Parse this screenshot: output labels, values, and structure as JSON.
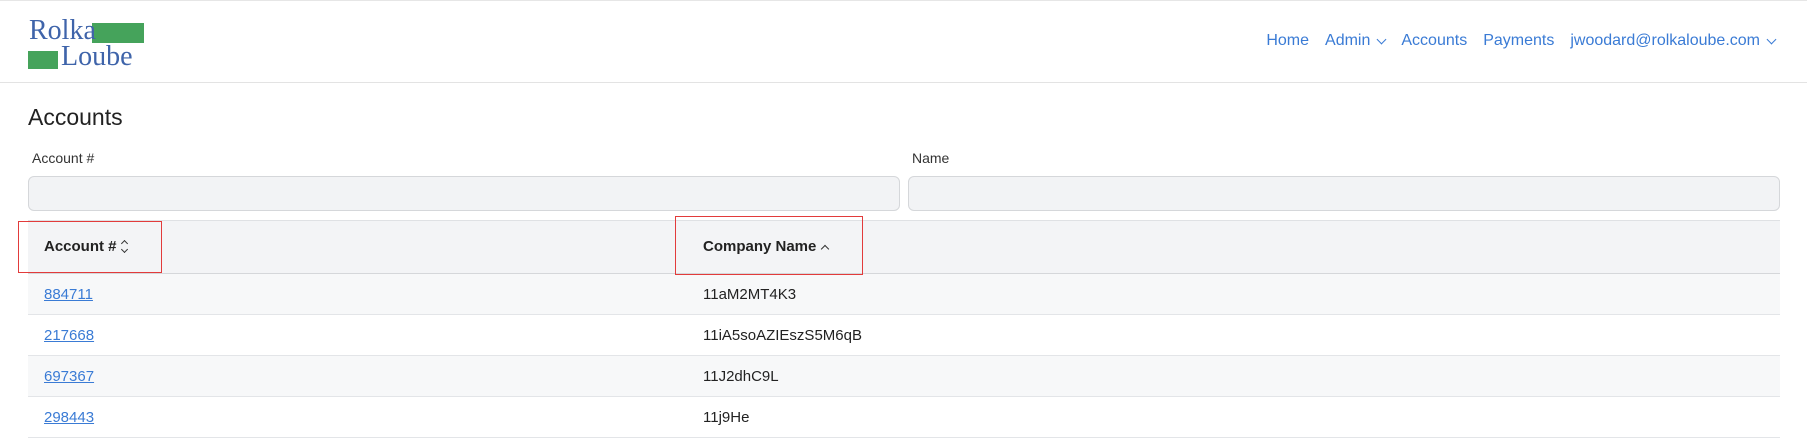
{
  "brand": {
    "line1": "Rolka",
    "line2": "Loube",
    "colors": {
      "text": "#3f64aa",
      "accent": "#45a35b"
    }
  },
  "nav": {
    "items": [
      {
        "label": "Home",
        "dropdown": false
      },
      {
        "label": "Admin",
        "dropdown": true
      },
      {
        "label": "Accounts",
        "dropdown": false
      },
      {
        "label": "Payments",
        "dropdown": false
      },
      {
        "label": "jwoodard@rolkaloube.com",
        "dropdown": true
      }
    ],
    "link_color": "#3a7bd5"
  },
  "page": {
    "title": "Accounts"
  },
  "filters": {
    "account_label": "Account #",
    "account_value": "",
    "name_label": "Name",
    "name_value": ""
  },
  "table": {
    "headers": {
      "account": "Account #",
      "company": "Company Name"
    },
    "sort": {
      "account": "none",
      "company": "ascending"
    },
    "rows": [
      {
        "account": "884711",
        "company": "11aM2MT4K3"
      },
      {
        "account": "217668",
        "company": "11iA5soAZIEszS5M6qB"
      },
      {
        "account": "697367",
        "company": "11J2dhC9L"
      },
      {
        "account": "298443",
        "company": "11j9He"
      }
    ]
  },
  "highlight_color": "#e23b3b"
}
